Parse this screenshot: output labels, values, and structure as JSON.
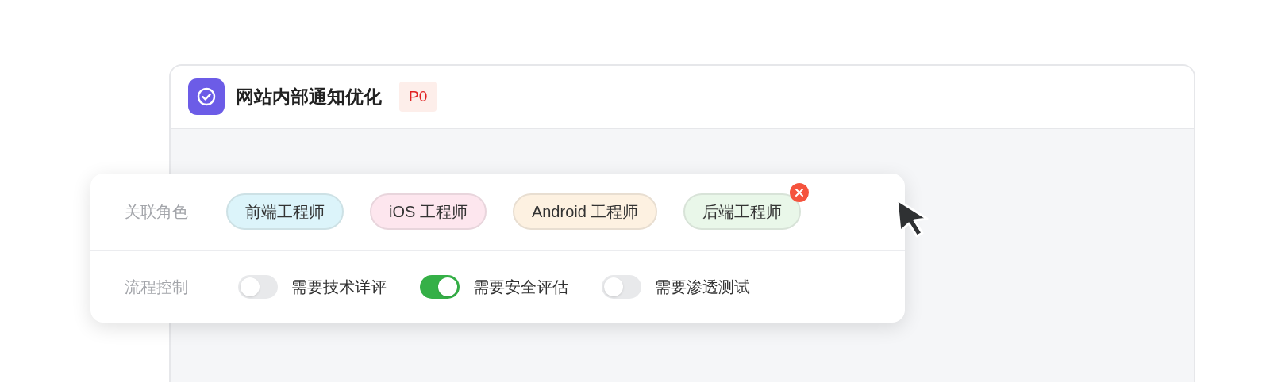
{
  "task": {
    "title": "网站内部通知优化",
    "priority": "P0"
  },
  "roles": {
    "label": "关联角色",
    "tags": [
      {
        "label": "前端工程师",
        "color": "#dcf4fa",
        "hovered": false
      },
      {
        "label": "iOS 工程师",
        "color": "#fde6ee",
        "hovered": false
      },
      {
        "label": "Android 工程师",
        "color": "#fdf1e1",
        "hovered": false
      },
      {
        "label": "后端工程师",
        "color": "#e9f7e9",
        "hovered": true
      }
    ]
  },
  "process": {
    "label": "流程控制",
    "switches": [
      {
        "label": "需要技术详评",
        "on": false
      },
      {
        "label": "需要安全评估",
        "on": true
      },
      {
        "label": "需要渗透测试",
        "on": false
      }
    ]
  }
}
